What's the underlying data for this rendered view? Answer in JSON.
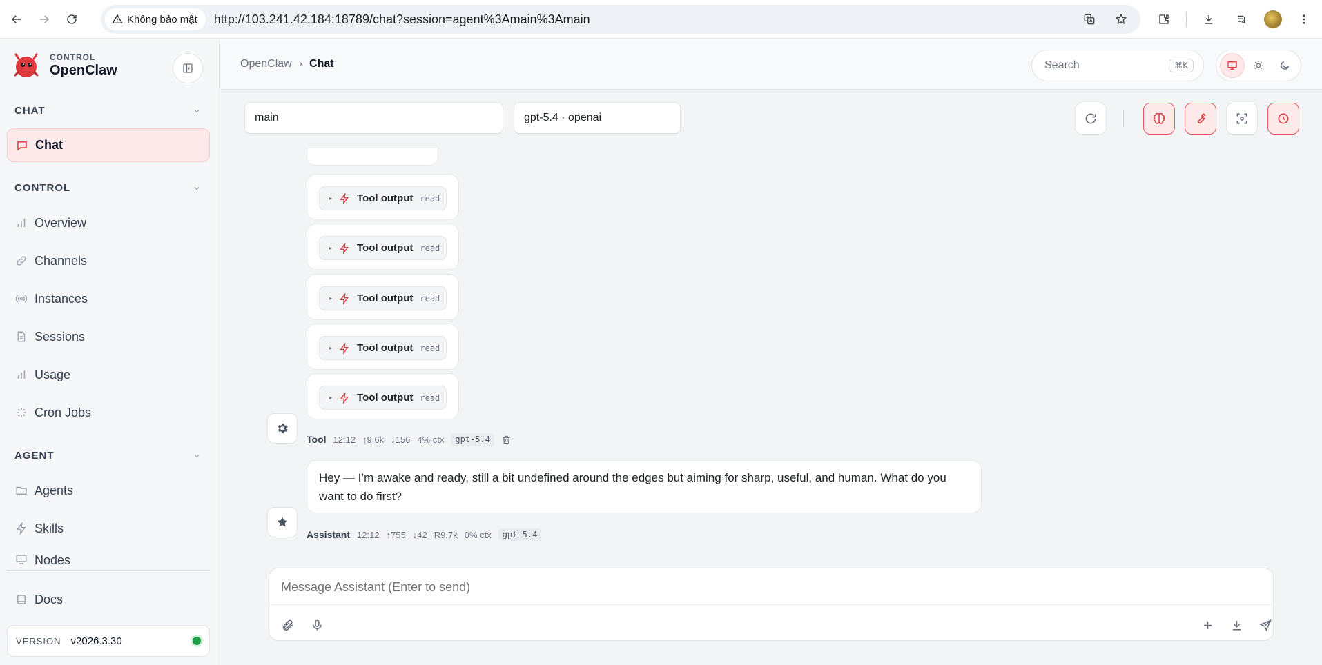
{
  "browser": {
    "security_label": "Không bảo mật",
    "url": "http://103.241.42.184:18789/chat?session=agent%3Amain%3Amain"
  },
  "brand": {
    "kicker": "CONTROL",
    "title": "OpenClaw"
  },
  "sidebar": {
    "sections": [
      {
        "label": "CHAT",
        "items": [
          {
            "label": "Chat",
            "icon": "chat-bubble-icon",
            "active": true
          }
        ]
      },
      {
        "label": "CONTROL",
        "items": [
          {
            "label": "Overview",
            "icon": "bar-chart-icon"
          },
          {
            "label": "Channels",
            "icon": "link-icon"
          },
          {
            "label": "Instances",
            "icon": "broadcast-icon"
          },
          {
            "label": "Sessions",
            "icon": "document-icon"
          },
          {
            "label": "Usage",
            "icon": "bar-chart-icon"
          },
          {
            "label": "Cron Jobs",
            "icon": "loader-icon"
          }
        ]
      },
      {
        "label": "AGENT",
        "items": [
          {
            "label": "Agents",
            "icon": "folder-icon"
          },
          {
            "label": "Skills",
            "icon": "lightning-icon"
          },
          {
            "label": "Nodes",
            "icon": "monitor-icon"
          }
        ]
      }
    ],
    "docs_label": "Docs",
    "version_label": "VERSION",
    "version_value": "v2026.3.30"
  },
  "topbar": {
    "breadcrumb_root": "OpenClaw",
    "breadcrumb_sep": "›",
    "breadcrumb_current": "Chat",
    "search_placeholder": "Search",
    "search_shortcut": "⌘K"
  },
  "chat": {
    "session_select": "main",
    "model_select": "gpt-5.4 · openai",
    "tool_outputs": [
      {
        "label": "Tool output",
        "kind": "read"
      },
      {
        "label": "Tool output",
        "kind": "read"
      },
      {
        "label": "Tool output",
        "kind": "read"
      },
      {
        "label": "Tool output",
        "kind": "read"
      },
      {
        "label": "Tool output",
        "kind": "read"
      }
    ],
    "tool_meta": {
      "who": "Tool",
      "time": "12:12",
      "up": "↑9.6k",
      "down": "↓156",
      "ctx": "4% ctx",
      "model": "gpt-5.4"
    },
    "assistant_message": "Hey — I’m awake and ready, still a bit undefined around the edges but aiming for sharp, useful, and human. What do you want to do first?",
    "assistant_meta": {
      "who": "Assistant",
      "time": "12:12",
      "up": "↑755",
      "down": "↓42",
      "r": "R9.7k",
      "ctx": "0% ctx",
      "model": "gpt-5.4"
    },
    "composer_placeholder": "Message Assistant (Enter to send)"
  },
  "colors": {
    "accent": "#dc3a3e",
    "accent_bg": "#fde9ea",
    "status_ok": "#22a04b"
  }
}
